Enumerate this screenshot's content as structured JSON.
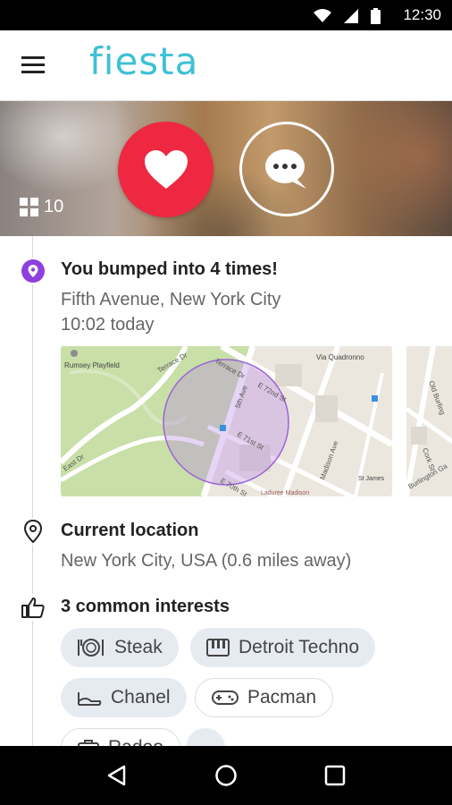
{
  "status_bar": {
    "time": "12:30",
    "icons": [
      "wifi-icon",
      "signal-icon",
      "battery-icon"
    ]
  },
  "app_bar": {
    "logo": "fiesta",
    "menu_icon": "hamburger-menu-icon"
  },
  "hero": {
    "like_icon": "heart-icon",
    "chat_icon": "chat-bubble-icon",
    "photo_count": "10",
    "accent_color": "#ee2841"
  },
  "encounter": {
    "title": "You bumped into 4 times!",
    "location": "Fifth Avenue, New York City",
    "time": "10:02 today",
    "icon": "location-pin-icon",
    "icon_color": "#8e3fe0",
    "map": {
      "labels": [
        "Rumsey Playfield",
        "Terrace Dr",
        "Terrace Dr",
        "E 72nd St",
        "Via Quadronno",
        "5th Ave",
        "E 71st St",
        "Madison Ave",
        "E 70th St",
        "Laduree Madison",
        "St James",
        "East Dr",
        "Old Burling",
        "Cork St",
        "Burlington Ga"
      ]
    }
  },
  "current_location": {
    "title": "Current location",
    "value": "New York City, USA (0.6 miles away)",
    "icon": "location-outline-icon"
  },
  "interests": {
    "title": "3 common interests",
    "icon": "thumbs-up-icon",
    "chips": [
      {
        "label": "Steak",
        "icon": "plate-cutlery-icon",
        "style": "filled"
      },
      {
        "label": "Detroit Techno",
        "icon": "piano-keys-icon",
        "style": "filled"
      },
      {
        "label": "Chanel",
        "icon": "high-heel-icon",
        "style": "filled"
      },
      {
        "label": "Pacman",
        "icon": "gamepad-icon",
        "style": "outline"
      },
      {
        "label": "Radeo",
        "icon": "briefcase-icon",
        "style": "outline"
      },
      {
        "label": "",
        "icon": "more-icon",
        "style": "filled"
      }
    ]
  },
  "nav_bar": {
    "back": "back-triangle-icon",
    "home": "home-circle-icon",
    "recents": "recents-square-icon"
  }
}
